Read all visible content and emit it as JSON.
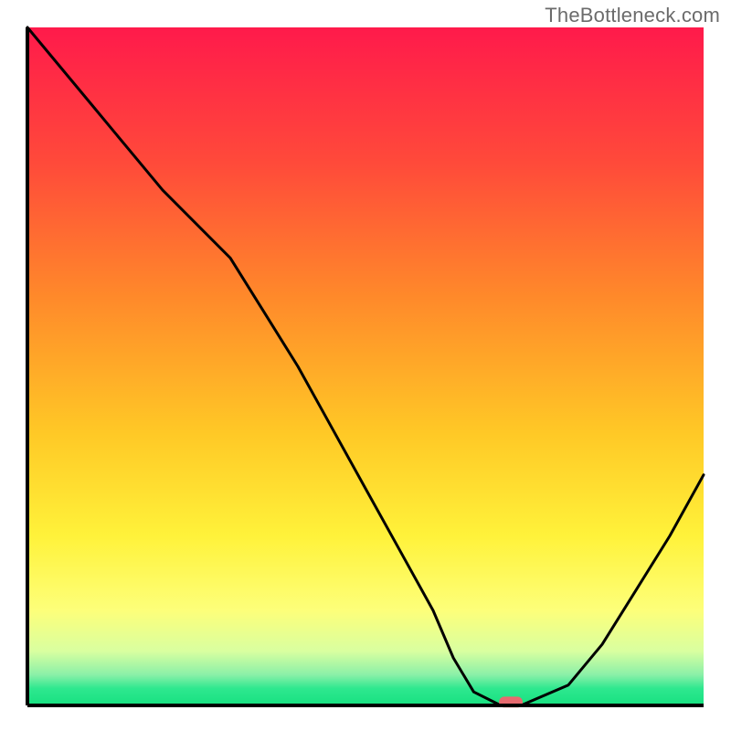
{
  "watermark": "TheBottleneck.com",
  "chart_data": {
    "type": "line",
    "title": "",
    "xlabel": "",
    "ylabel": "",
    "xlim": [
      0,
      100
    ],
    "ylim": [
      0,
      100
    ],
    "grid": false,
    "legend": false,
    "annotations": [],
    "background_gradient_stops": [
      {
        "offset": 0.0,
        "color": "#ff1a4b"
      },
      {
        "offset": 0.2,
        "color": "#ff4a3a"
      },
      {
        "offset": 0.4,
        "color": "#ff8a2a"
      },
      {
        "offset": 0.6,
        "color": "#ffc926"
      },
      {
        "offset": 0.75,
        "color": "#fff23a"
      },
      {
        "offset": 0.86,
        "color": "#fdff7a"
      },
      {
        "offset": 0.92,
        "color": "#d9ffa0"
      },
      {
        "offset": 0.955,
        "color": "#8af0a8"
      },
      {
        "offset": 0.975,
        "color": "#2ee88f"
      },
      {
        "offset": 1.0,
        "color": "#17e080"
      }
    ],
    "series": [
      {
        "name": "bottleneck-curve",
        "x": [
          0,
          5,
          10,
          15,
          20,
          25,
          30,
          35,
          40,
          45,
          50,
          55,
          60,
          63,
          66,
          70,
          73,
          80,
          85,
          90,
          95,
          100
        ],
        "values": [
          100,
          94,
          88,
          82,
          76,
          71,
          66,
          58,
          50,
          41,
          32,
          23,
          14,
          7,
          2,
          0,
          0,
          3,
          9,
          17,
          25,
          34
        ]
      }
    ],
    "marker": {
      "name": "optimal-range-marker",
      "x_center": 71.5,
      "y": 0.5,
      "width_pct": 3.5,
      "height_pct": 1.6,
      "color": "#e76a6f"
    }
  }
}
